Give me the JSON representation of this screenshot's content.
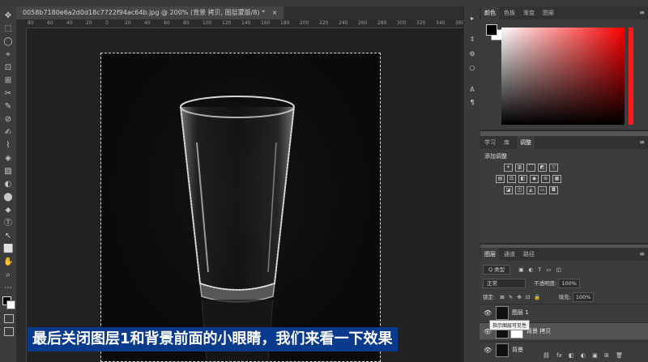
{
  "document": {
    "tab_title": "0058b7180e6a2d0d18c7722f94ac64b.jpg @ 200% (背景 拷贝, 图层蒙版/8) *",
    "tab_close": "×"
  },
  "ruler": {
    "marks": [
      "80",
      "60",
      "40",
      "20",
      "0",
      "20",
      "40",
      "60",
      "80",
      "100",
      "120",
      "140",
      "160",
      "180",
      "200",
      "220",
      "240",
      "260",
      "280",
      "300",
      "320",
      "340",
      "360"
    ]
  },
  "tools": [
    "✥",
    "⬚",
    "◯",
    "⌖",
    "⊡",
    "⊞",
    "✂",
    "✎",
    "⊘",
    "✍",
    "⌇",
    "◈",
    "▨",
    "◐",
    "⬤",
    "⬥",
    "⬦",
    "⬧",
    "Ⓣ",
    "↖",
    "⬜",
    "✋",
    "⌕",
    "⋯"
  ],
  "side_icons": [
    "▸",
    "⇕",
    "⚙",
    "⎔",
    "A",
    "¶"
  ],
  "color_panel": {
    "tabs": [
      "颜色",
      "色板",
      "渐变",
      "图案"
    ],
    "fg_color": "#000000",
    "bg_color": "#ffffff"
  },
  "adjust_panel": {
    "tabs": [
      "学习",
      "库",
      "调整"
    ],
    "add_label": "添加调整"
  },
  "layers_panel": {
    "tabs": [
      "图层",
      "通道",
      "路径"
    ],
    "filter_kind": "Q 类型",
    "blend_mode": "正常",
    "opacity_label": "不透明度:",
    "opacity_value": "100%",
    "lock_label": "锁定:",
    "fill_label": "填充:",
    "fill_value": "100%",
    "layers": [
      {
        "name": "图层 1",
        "selected": false
      },
      {
        "name": "背景 拷贝",
        "selected": true
      },
      {
        "name": "背景",
        "selected": false
      }
    ],
    "tooltip": "指示图层可见性",
    "bottom_icons": [
      "⛓",
      "fx",
      "◧",
      "◐",
      "▣",
      "⊞",
      "🗑"
    ]
  },
  "subtitle": "最后关闭图层1和背景前面的小眼睛，我们来看一下效果"
}
